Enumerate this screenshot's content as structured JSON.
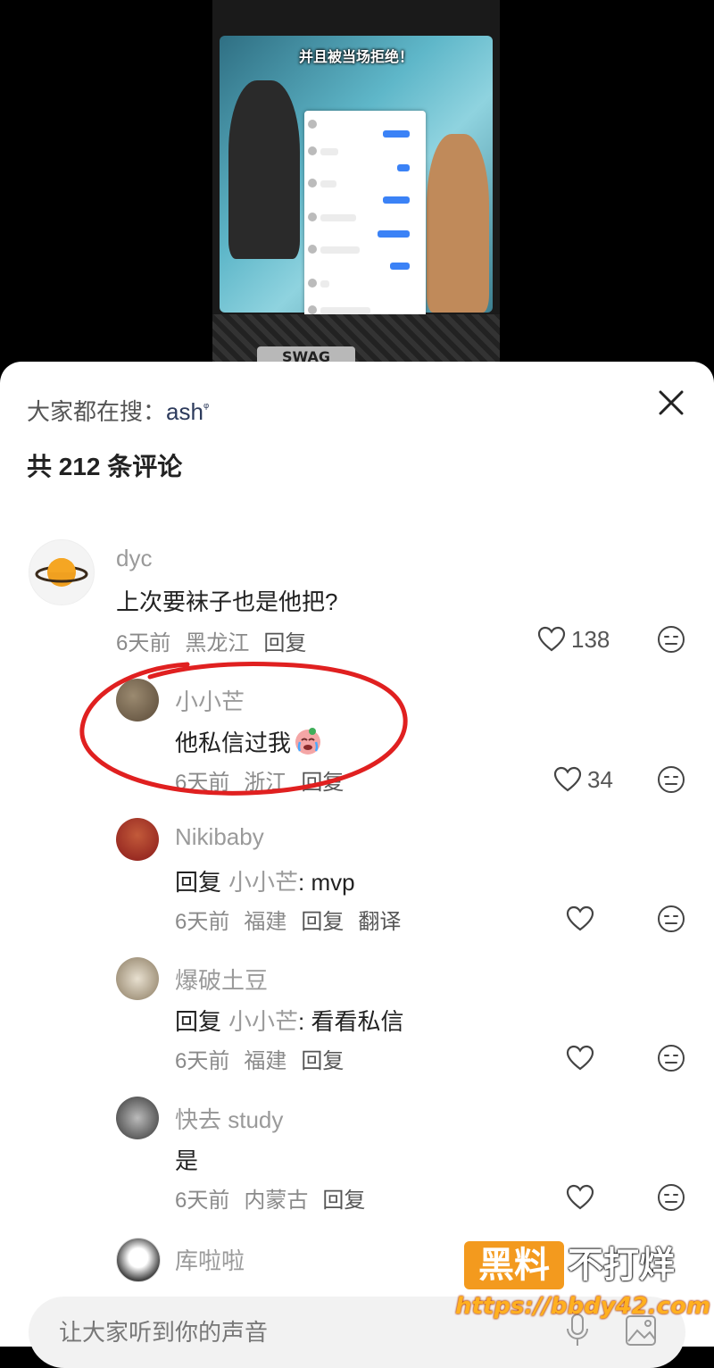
{
  "video": {
    "caption": "并且被当场拒绝！",
    "logo_text": "SWAG"
  },
  "sheet": {
    "search_prefix": "大家都在搜：",
    "search_keyword": "ash",
    "comment_count_label": "共 212 条评论"
  },
  "comments": [
    {
      "username": "dyc",
      "text": "上次要袜子也是他把?",
      "time": "6天前",
      "location": "黑龙江",
      "reply_label": "回复",
      "likes": "138"
    },
    {
      "username": "小小芒",
      "text": "他私信过我",
      "time": "6天前",
      "location": "浙江",
      "reply_label": "回复",
      "likes": "34"
    },
    {
      "username": "Nikibaby",
      "reply_prefix": "回复",
      "mention": "小小芒",
      "text": ": mvp",
      "time": "6天前",
      "location": "福建",
      "reply_label": "回复",
      "translate_label": "翻译",
      "likes": ""
    },
    {
      "username": "爆破土豆",
      "reply_prefix": "回复",
      "mention": "小小芒",
      "text": ": 看看私信",
      "time": "6天前",
      "location": "福建",
      "reply_label": "回复",
      "likes": ""
    },
    {
      "username": "快去 study",
      "text": "是",
      "time": "6天前",
      "location": "内蒙古",
      "reply_label": "回复",
      "likes": ""
    },
    {
      "username": "库啦啦"
    }
  ],
  "input": {
    "placeholder": "让大家听到你的声音"
  },
  "watermark": {
    "box_text": "黑料",
    "text": "不打烊",
    "url": "https://bbdy42.com"
  },
  "colors": {
    "annotation_red": "#e02020",
    "watermark_orange": "#f39a1e"
  }
}
